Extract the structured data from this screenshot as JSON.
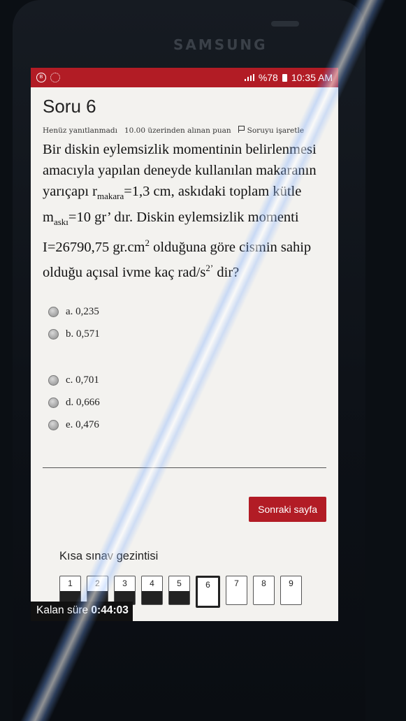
{
  "device": {
    "brand": "SAMSUNG"
  },
  "statusbar": {
    "battery": "%78",
    "time": "10:35 AM"
  },
  "question": {
    "title": "Soru 6",
    "status": "Henüz yanıtlanmadı",
    "points": "10.00 üzerinden alınan puan",
    "flag_label": "Soruyu işaretle",
    "text_1": "Bir diskin eylemsizlik momentinin belirlenmesi amacıyla yapılan deneyde kullanılan makaranın yarıçapı r",
    "sub_1": "makara",
    "text_2": "=1,3 cm, askıdaki toplam kütle m",
    "sub_2": "askı",
    "text_3": "=10 gr’ dır. Diskin eylemsizlik momenti I=26790,75 gr.cm",
    "sup_1": "2",
    "text_4": " olduğuna göre cismin sahip olduğu açısal ivme kaç rad/s",
    "sup_2": "2’",
    "text_5": " dir?"
  },
  "options": [
    {
      "label": "a. 0,235"
    },
    {
      "label": "b. 0,571"
    },
    {
      "label": "c. 0,701"
    },
    {
      "label": "d. 0,666"
    },
    {
      "label": "e. 0,476"
    }
  ],
  "next_button": "Sonraki sayfa",
  "quiz_nav": {
    "title": "Kısa sınav gezintisi",
    "items": [
      {
        "n": "1",
        "state": "answered"
      },
      {
        "n": "2",
        "state": "answered"
      },
      {
        "n": "3",
        "state": "answered"
      },
      {
        "n": "4",
        "state": "answered"
      },
      {
        "n": "5",
        "state": "answered"
      },
      {
        "n": "6",
        "state": "current"
      },
      {
        "n": "7",
        "state": "empty"
      },
      {
        "n": "8",
        "state": "empty"
      },
      {
        "n": "9",
        "state": "empty"
      }
    ]
  },
  "timer": {
    "label": "Kalan süre",
    "value": "0:44:03"
  },
  "colors": {
    "accent": "#b21c25"
  }
}
